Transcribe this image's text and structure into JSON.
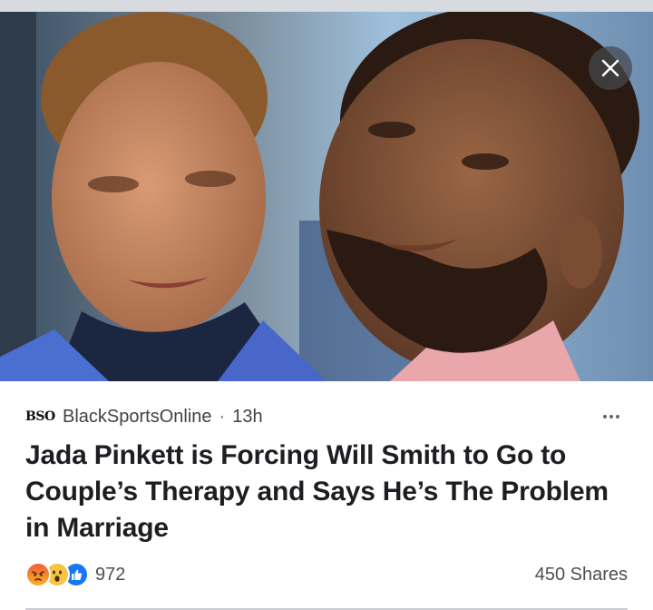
{
  "post": {
    "source": {
      "logo_text": "BSO",
      "name": "BlackSportsOnline",
      "separator": "·",
      "time": "13h"
    },
    "headline": "Jada Pinkett is Forcing Will Smith to Go to Couple’s Therapy and Says He’s The Problem in Marriage",
    "reactions": {
      "types": [
        "angry",
        "wow",
        "like"
      ],
      "count": "972"
    },
    "shares": "450 Shares"
  },
  "icons": {
    "close": "close-icon",
    "more": "more-options-icon"
  },
  "colors": {
    "text": "#1c1e21",
    "secondary": "#4b4f56",
    "like_blue": "#1877f2",
    "logo_red": "#c4161c"
  }
}
